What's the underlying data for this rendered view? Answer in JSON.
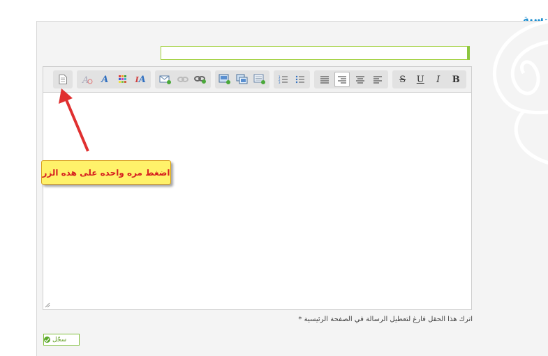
{
  "header": {
    "title_fragment": "يسية"
  },
  "toolbar": {
    "groups": [
      {
        "name": "source",
        "buttons": [
          "new-document-icon"
        ]
      },
      {
        "name": "text-style",
        "buttons": [
          "remove-format-icon",
          "font-icon",
          "color-icon",
          "font-size-icon"
        ]
      },
      {
        "name": "insert",
        "buttons": [
          "email-icon",
          "unlink-icon",
          "link-icon"
        ]
      },
      {
        "name": "media",
        "buttons": [
          "image-icon",
          "table-icon",
          "video-icon"
        ]
      },
      {
        "name": "lists",
        "buttons": [
          "numbered-list-icon",
          "bullet-list-icon"
        ]
      },
      {
        "name": "align",
        "buttons": [
          "align-left-icon",
          "align-right-icon",
          "align-center-icon",
          "align-justify-icon"
        ]
      },
      {
        "name": "format",
        "buttons": [
          "strikethrough-icon",
          "underline-icon",
          "italic-icon",
          "bold-icon"
        ]
      }
    ],
    "format_labels": {
      "strike": "S",
      "underline": "U",
      "italic": "I",
      "bold": "B"
    },
    "font_label": "A",
    "size_label": "A"
  },
  "callout": {
    "text": "اضغط مره واحده على هذه الزر"
  },
  "note": {
    "text": "اترك هذا الحقل فارغ لتعطيل الرسالة في الصفحة الرئيسية",
    "star": "*"
  },
  "submit": {
    "label": "سجّل"
  },
  "colors": {
    "accent_green": "#8cc63f",
    "title_blue": "#1f8fd0",
    "callout_bg": "#fff26a",
    "callout_text": "#d62020"
  }
}
